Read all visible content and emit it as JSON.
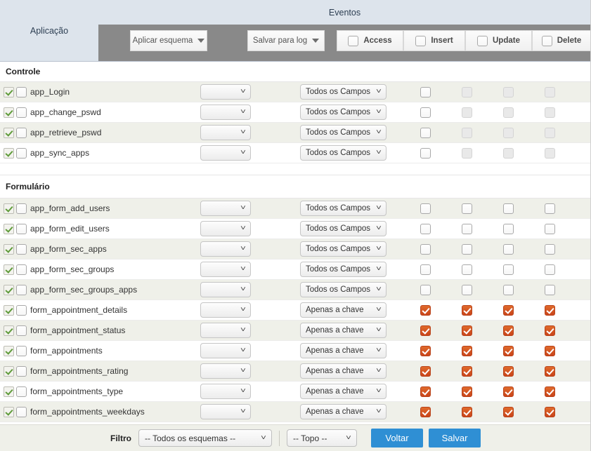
{
  "header": {
    "app_column_label": "Aplicação",
    "events_group_label": "Eventos",
    "buttons": {
      "apply_scheme": "Aplicar esquema",
      "save_to_log": "Salvar para log"
    },
    "event_columns": [
      {
        "label": "Access",
        "checked": false
      },
      {
        "label": "Insert",
        "checked": false
      },
      {
        "label": "Update",
        "checked": false
      },
      {
        "label": "Delete",
        "checked": false
      }
    ]
  },
  "sections": [
    {
      "title": "Controle",
      "rows": [
        {
          "name": "app_Login",
          "scheme": "",
          "fields": "Todos os Campos",
          "events": [
            "off",
            "disabled",
            "disabled",
            "disabled"
          ]
        },
        {
          "name": "app_change_pswd",
          "scheme": "",
          "fields": "Todos os Campos",
          "events": [
            "off",
            "disabled",
            "disabled",
            "disabled"
          ]
        },
        {
          "name": "app_retrieve_pswd",
          "scheme": "",
          "fields": "Todos os Campos",
          "events": [
            "off",
            "disabled",
            "disabled",
            "disabled"
          ]
        },
        {
          "name": "app_sync_apps",
          "scheme": "",
          "fields": "Todos os Campos",
          "events": [
            "off",
            "disabled",
            "disabled",
            "disabled"
          ]
        }
      ]
    },
    {
      "title": "Formulário",
      "rows": [
        {
          "name": "app_form_add_users",
          "scheme": "",
          "fields": "Todos os Campos",
          "events": [
            "off",
            "off",
            "off",
            "off"
          ]
        },
        {
          "name": "app_form_edit_users",
          "scheme": "",
          "fields": "Todos os Campos",
          "events": [
            "off",
            "off",
            "off",
            "off"
          ]
        },
        {
          "name": "app_form_sec_apps",
          "scheme": "",
          "fields": "Todos os Campos",
          "events": [
            "off",
            "off",
            "off",
            "off"
          ]
        },
        {
          "name": "app_form_sec_groups",
          "scheme": "",
          "fields": "Todos os Campos",
          "events": [
            "off",
            "off",
            "off",
            "off"
          ]
        },
        {
          "name": "app_form_sec_groups_apps",
          "scheme": "",
          "fields": "Todos os Campos",
          "events": [
            "off",
            "off",
            "off",
            "off"
          ]
        },
        {
          "name": "form_appointment_details",
          "scheme": "",
          "fields": "Apenas a chave",
          "events": [
            "on",
            "on",
            "on",
            "on"
          ]
        },
        {
          "name": "form_appointment_status",
          "scheme": "",
          "fields": "Apenas a chave",
          "events": [
            "on",
            "on",
            "on",
            "on"
          ]
        },
        {
          "name": "form_appointments",
          "scheme": "",
          "fields": "Apenas a chave",
          "events": [
            "on",
            "on",
            "on",
            "on"
          ]
        },
        {
          "name": "form_appointments_rating",
          "scheme": "",
          "fields": "Apenas a chave",
          "events": [
            "on",
            "on",
            "on",
            "on"
          ]
        },
        {
          "name": "form_appointments_type",
          "scheme": "",
          "fields": "Apenas a chave",
          "events": [
            "on",
            "on",
            "on",
            "on"
          ]
        },
        {
          "name": "form_appointments_weekdays",
          "scheme": "",
          "fields": "Apenas a chave",
          "events": [
            "on",
            "on",
            "on",
            "on"
          ]
        }
      ]
    }
  ],
  "footer": {
    "filter_label": "Filtro",
    "scheme_filter_value": "-- Todos os esquemas --",
    "position_filter_value": "-- Topo --",
    "back_button": "Voltar",
    "save_button": "Salvar"
  },
  "colors": {
    "header_bg": "#dde4ec",
    "toolbar_bg": "#898989",
    "checked_checkbox": "#d1551f",
    "primary_button": "#2f8fd4",
    "alt_row": "#eff0e9",
    "green_check": "#5f9b3a"
  }
}
